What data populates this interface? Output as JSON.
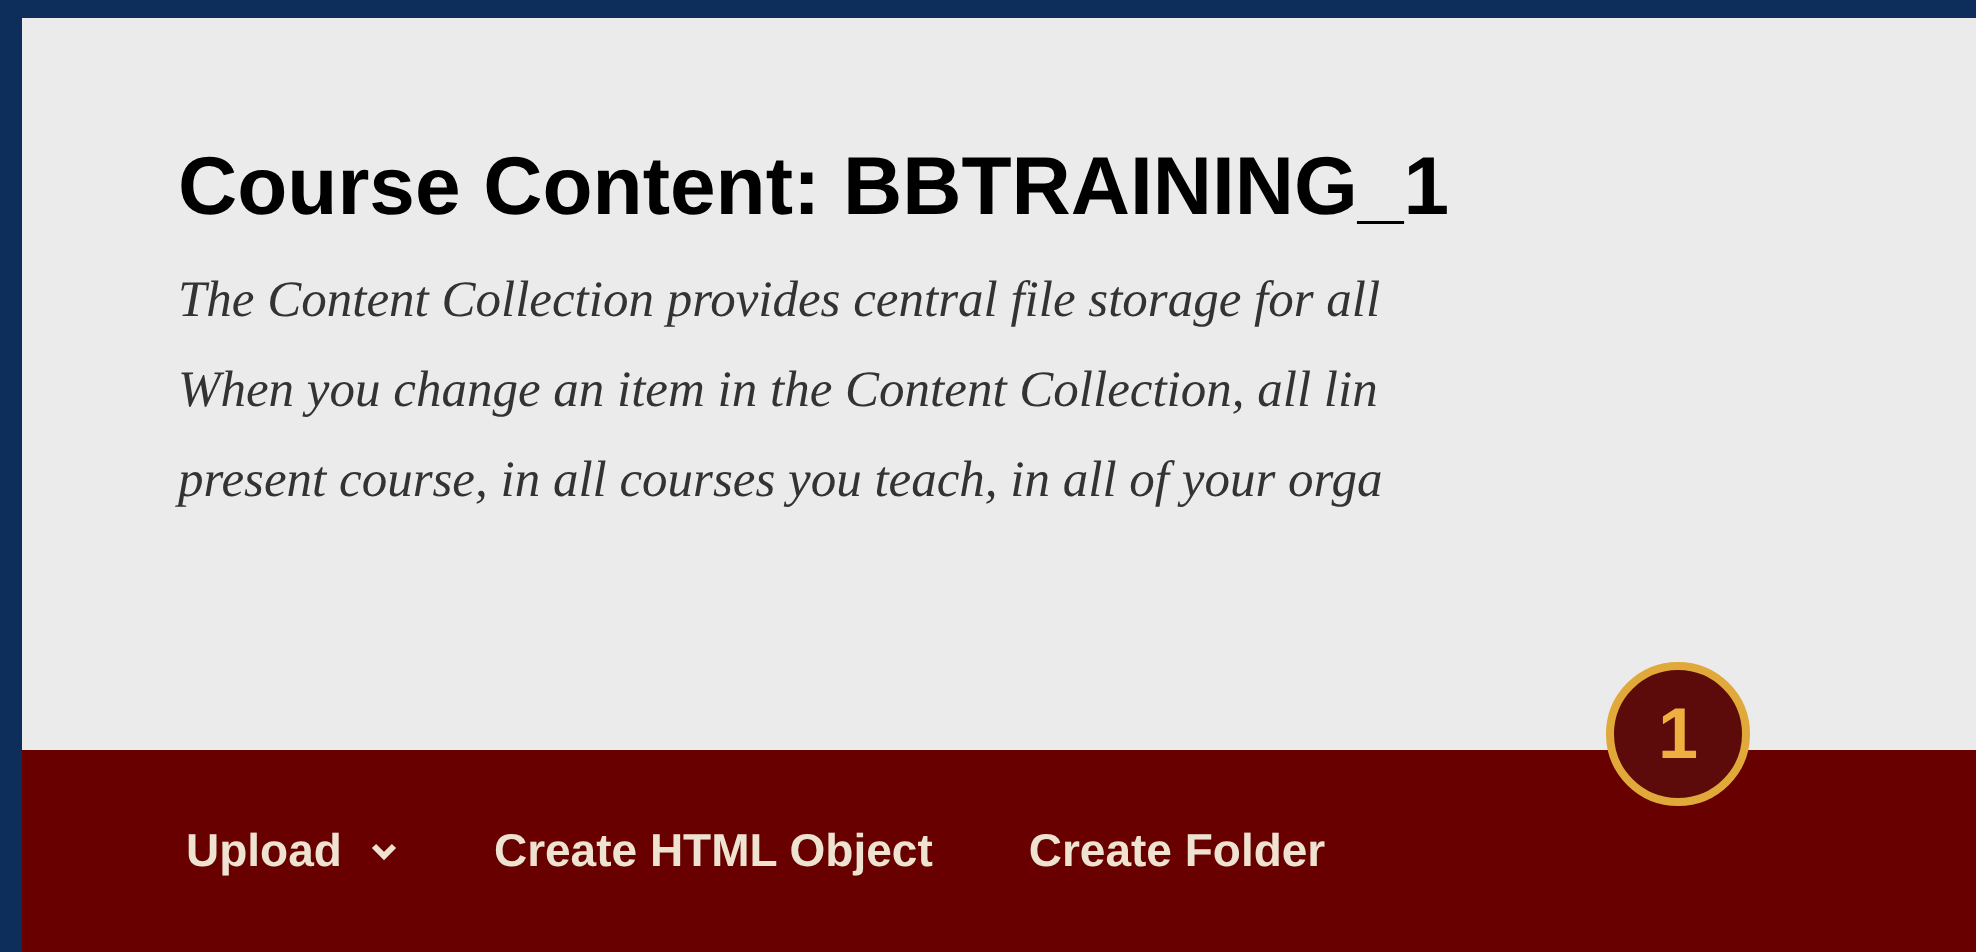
{
  "title": "Course Content: BBTRAINING_1",
  "description": [
    "The Content Collection provides central file storage for all",
    "When you change an item in the Content Collection, all lin",
    "present course, in all courses you teach, in all of your orga"
  ],
  "callout": {
    "number": "1"
  },
  "toolbar": [
    {
      "label": "Upload",
      "kind": "menu"
    },
    {
      "label": "Create HTML Object",
      "kind": "action"
    },
    {
      "label": "Create Folder",
      "kind": "action"
    }
  ]
}
